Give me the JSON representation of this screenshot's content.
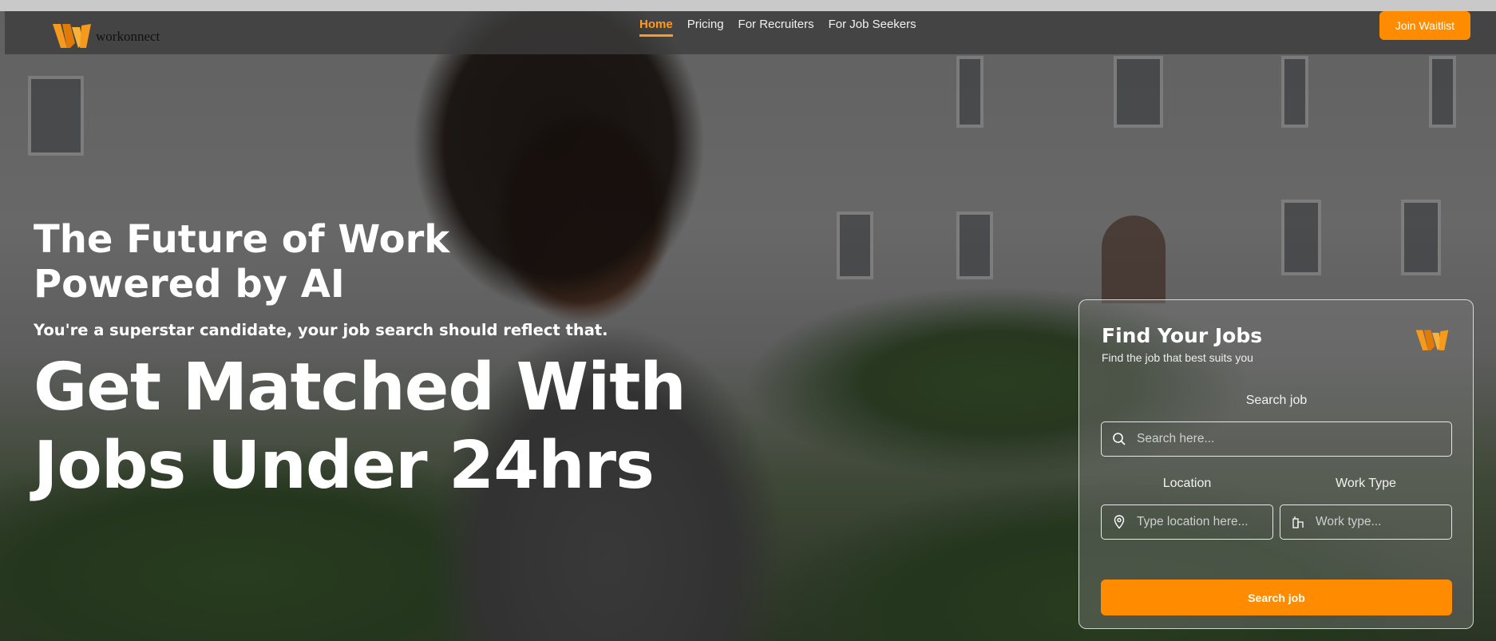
{
  "brand": {
    "name": "workonnect",
    "accent": "#ff8c00",
    "logo_icon": "w-logo-icon"
  },
  "nav": {
    "items": [
      {
        "label": "Home",
        "active": true
      },
      {
        "label": "Pricing",
        "active": false
      },
      {
        "label": "For Recruiters",
        "active": false
      },
      {
        "label": "For Job Seekers",
        "active": false
      }
    ],
    "cta": "Join Waitlist"
  },
  "hero": {
    "headline": "The Future of Work Powered by AI",
    "tagline": "You're a superstar candidate, your job search should reflect that.",
    "big": "Get Matched With Jobs Under 24hrs"
  },
  "card": {
    "title": "Find Your Jobs",
    "subtitle": "Find the job that best suits you",
    "search_label": "Search job",
    "search_placeholder": "Search here...",
    "location_label": "Location",
    "location_placeholder": "Type location here...",
    "worktype_label": "Work Type",
    "worktype_placeholder": "Work type...",
    "button": "Search job"
  }
}
